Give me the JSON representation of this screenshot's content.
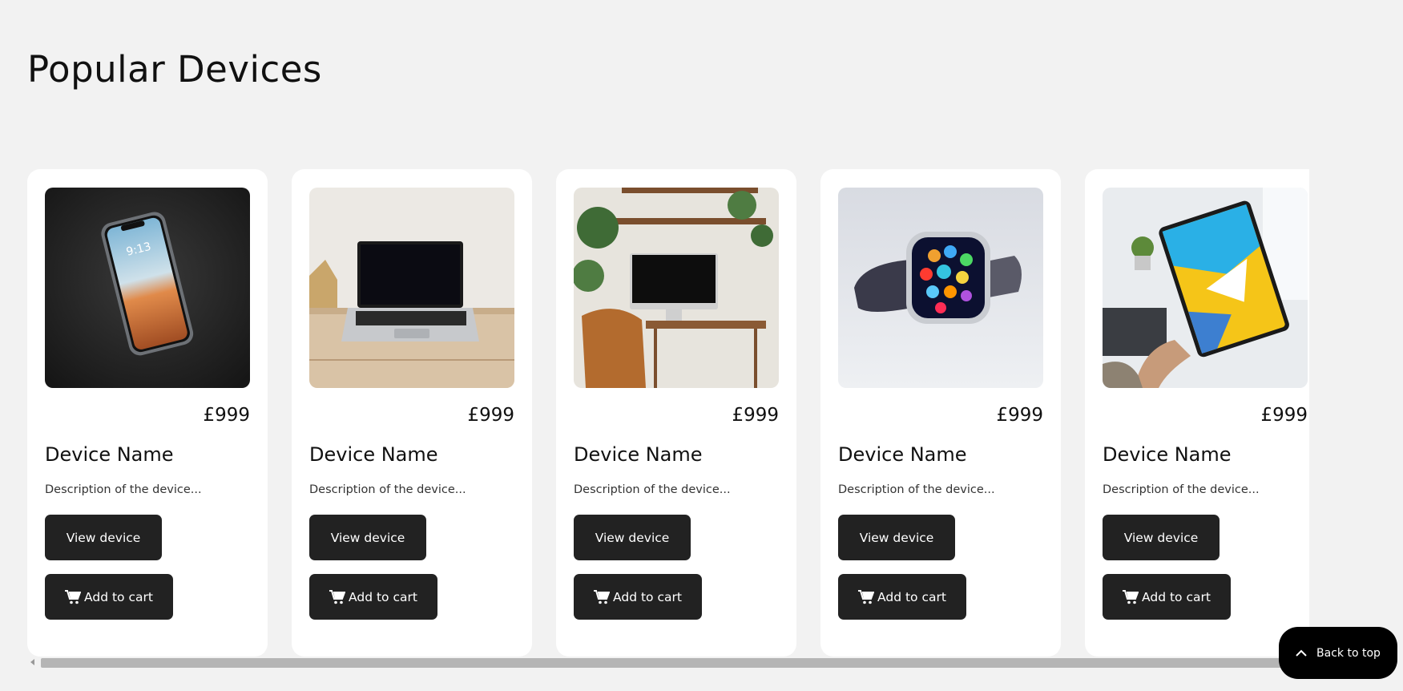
{
  "section": {
    "title": "Popular Devices"
  },
  "cards": [
    {
      "image": "smartphone-photo",
      "price": "£999",
      "name": "Device Name",
      "description": "Description of the device...",
      "view_label": "View device",
      "cart_label": "Add to cart"
    },
    {
      "image": "laptop-photo",
      "price": "£999",
      "name": "Device Name",
      "description": "Description of the device...",
      "view_label": "View device",
      "cart_label": "Add to cart"
    },
    {
      "image": "desktop-computer-photo",
      "price": "£999",
      "name": "Device Name",
      "description": "Description of the device...",
      "view_label": "View device",
      "cart_label": "Add to cart"
    },
    {
      "image": "smartwatch-photo",
      "price": "£999",
      "name": "Device Name",
      "description": "Description of the device...",
      "view_label": "View device",
      "cart_label": "Add to cart"
    },
    {
      "image": "tablet-photo",
      "price": "£999",
      "name": "Device Name",
      "description": "Description of the device...",
      "view_label": "View device",
      "cart_label": "Add to cart"
    }
  ],
  "back_to_top": {
    "label": "Back to top",
    "icon": "chevron-up-icon"
  },
  "icons": {
    "cart": "shopping-cart-icon"
  },
  "colors": {
    "background": "#f2f2f2",
    "card": "#ffffff",
    "button": "#222222",
    "back_to_top": "#000000"
  }
}
